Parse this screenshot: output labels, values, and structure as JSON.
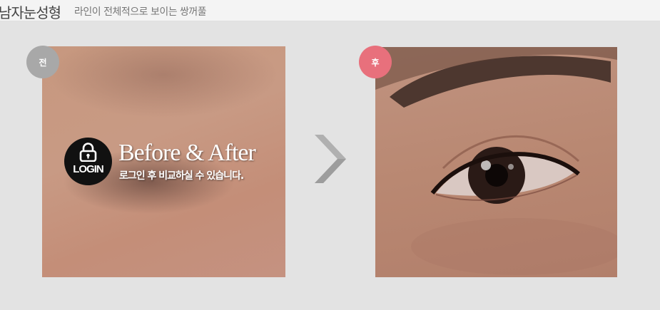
{
  "header": {
    "title": "남자눈성형",
    "subtitle": "라인이 전체적으로 보이는 쌍꺼풀"
  },
  "comparison": {
    "before_badge": "전",
    "after_badge": "후",
    "login_label": "LOGIN",
    "overlay_title": "Before & After",
    "overlay_subtitle": "로그인 후 비교하실 수 있습니다.",
    "next_arrow_icon": "chevron-right-icon"
  },
  "colors": {
    "before_badge": "#a8a8a8",
    "after_badge": "#e8707c",
    "lock_circle": "#111111",
    "arrow": "#aaaaaa"
  }
}
